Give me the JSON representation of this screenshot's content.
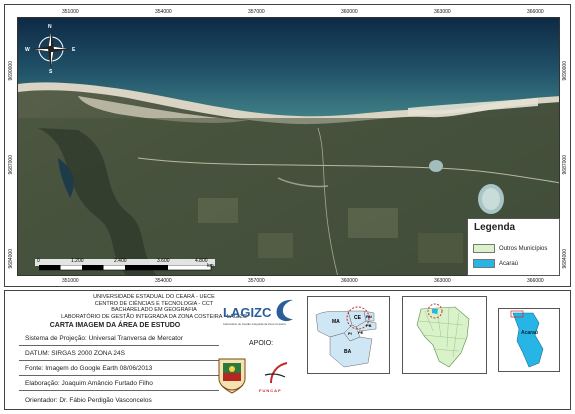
{
  "map": {
    "top_ticks": [
      "351000",
      "354000",
      "357000",
      "360000",
      "363000",
      "366000"
    ],
    "bottom_ticks": [
      "351000",
      "354000",
      "357000",
      "360000",
      "363000",
      "366000"
    ],
    "left_ticks": [
      "9690000",
      "9687000",
      "9684000"
    ],
    "right_ticks": [
      "9690000",
      "9687000",
      "9684000"
    ],
    "compass_labels": {
      "n": "N",
      "s": "S",
      "e": "E",
      "w": "W"
    },
    "scale": {
      "labels": [
        "0",
        "1.200",
        "2.400",
        "3.600",
        "4.800"
      ],
      "unit": "km"
    }
  },
  "legend": {
    "title": "Legenda",
    "items": [
      {
        "label": "Outros Municípios",
        "color": "#d9f2c9"
      },
      {
        "label": "Acaraú",
        "color": "#27b5e6"
      }
    ]
  },
  "institution": {
    "lines": [
      "UNIVERSIDADE ESTADUAL DO CEARÁ - UECE",
      "CENTRO DE CIÊNCIAS E TECNOLOGIA - CCT",
      "BACHARELADO EM GEOGRAFIA",
      "LABORATÓRIO DE GESTÃO INTEGRADA DA ZONA COSTEIRA - LAGIZC"
    ],
    "map_title": "CARTA IMAGEM DA ÁREA DE ESTUDO"
  },
  "info": {
    "projection": "Sistema de Projeção: Universal Tranversa de Mercator",
    "datum": "DATUM: SIRGAS 2000 ZONA 24S",
    "source": "Fonte: Imagem do Google Earth 08/06/2013",
    "author": "Elaboração: Joaquim Amâncio Furtado Filho",
    "advisor": "Orientador: Dr. Fábio Perdigão Vasconcelos"
  },
  "logos": {
    "lagizc": "LAGIZC",
    "lagizc_sub": "Laboratório de Gestão Integrada da Zona Costeira",
    "apoio": "APOIO:",
    "funcap": "FUNCAP"
  },
  "insets": {
    "brazil_states": [
      "MA",
      "CE",
      "RN",
      "PI",
      "PB",
      "PE",
      "BA"
    ],
    "acarau_label": "Acaraú"
  }
}
